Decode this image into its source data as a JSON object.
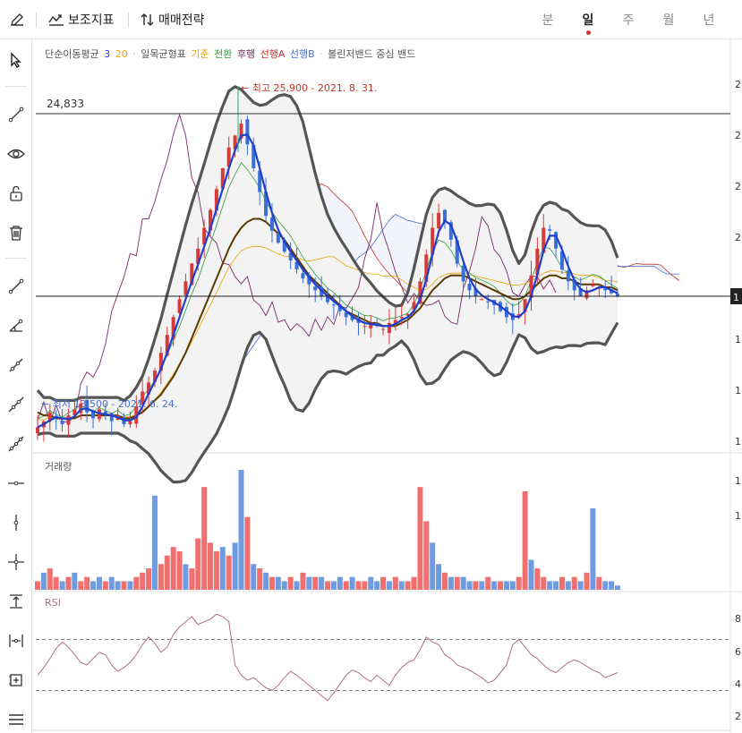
{
  "toolbar": {
    "indicators_label": "보조지표",
    "strategy_label": "매매전략",
    "periods": [
      "분",
      "일",
      "주",
      "월",
      "년"
    ],
    "active_period": "일"
  },
  "legend": {
    "sma_label": "단순이동평균",
    "sma_3": "3",
    "sma_20": "20",
    "sep": "·",
    "ichimoku_label": "일목균형표",
    "kijun": "기준",
    "tenkan": "전환",
    "chikou": "후행",
    "spanA": "선행A",
    "spanB": "선행B",
    "bollinger_label": "볼린저밴드 중심 밴드"
  },
  "colors": {
    "sma3": "#1f3fcf",
    "sma20": "#e8a400",
    "kijun": "#e8a400",
    "tenkan": "#2e9e3e",
    "chikou": "#7a2a6a",
    "spanA": "#c0352b",
    "spanB": "#4a6fd0",
    "bollinger": "#555555",
    "up": "#f07070",
    "down": "#6f9be0",
    "rsi": "#b07080"
  },
  "chart_data": [
    {
      "type": "candlestick",
      "price_line": "24,833",
      "high_annotation": "← 최고 25,900 - 2021. 8. 31.",
      "low_annotation": "← 최저 13,500 - 2021. 6. 24.",
      "high_value": 25900,
      "low_value": 13500,
      "current_reference": 18700,
      "right_axis_ticks": [
        "2",
        "2",
        "2",
        "2",
        "1",
        "1",
        "1",
        "1"
      ],
      "current_price_tag": "1",
      "close_series": [
        14300,
        14500,
        14800,
        14600,
        14400,
        14700,
        14900,
        15100,
        14800,
        14600,
        14900,
        14700,
        14500,
        14700,
        14400,
        14500,
        15000,
        15500,
        15800,
        16200,
        16800,
        17400,
        18000,
        18600,
        19200,
        19800,
        20300,
        21000,
        21600,
        22300,
        23000,
        23700,
        24100,
        24500,
        23800,
        23000,
        22200,
        21400,
        20900,
        20500,
        20200,
        19900,
        19600,
        19300,
        19100,
        18900,
        18700,
        18500,
        18400,
        18200,
        18000,
        17900,
        17800,
        17700,
        17800,
        17700,
        17600,
        17800,
        17900,
        18000,
        18100,
        18500,
        19200,
        20100,
        21000,
        21500,
        21200,
        20600,
        19800,
        19200,
        18900,
        18700,
        18600,
        18500,
        18400,
        18200,
        18000,
        17900,
        18100,
        18600,
        19400,
        20300,
        21000,
        20900,
        20300,
        19600,
        19200,
        18900,
        18700,
        18900,
        19100,
        19000,
        18900,
        18800,
        18700
      ],
      "sma20_series": [
        14800,
        14700,
        14700,
        14600,
        14600,
        14600,
        14600,
        14700,
        14700,
        14700,
        14700,
        14700,
        14700,
        14700,
        14600,
        14600,
        14700,
        14800,
        15000,
        15200,
        15400,
        15700,
        16000,
        16400,
        16800,
        17300,
        17800,
        18300,
        18800,
        19300,
        19800,
        20300,
        20700,
        21000,
        21200,
        21300,
        21300,
        21200,
        21000,
        20800,
        20600,
        20300,
        20000,
        19700,
        19400,
        19200,
        19000,
        18800,
        18600,
        18400,
        18200,
        18100,
        18000,
        17900,
        17800,
        17800,
        17700,
        17700,
        17700,
        17800,
        17900,
        18100,
        18300,
        18600,
        18900,
        19100,
        19300,
        19400,
        19400,
        19400,
        19300,
        19200,
        19100,
        19000,
        18900,
        18800,
        18700,
        18600,
        18600,
        18700,
        18900,
        19100,
        19300,
        19400,
        19400,
        19300,
        19300,
        19200,
        19100,
        19100,
        19100,
        19100,
        19000,
        19000,
        18900
      ]
    },
    {
      "type": "bar",
      "label": "거래량",
      "right_axis_ticks": [
        "1",
        "1"
      ],
      "volume_series": [
        2,
        4,
        5,
        3,
        2,
        3,
        4,
        2,
        3,
        2,
        3,
        2,
        3,
        2,
        2,
        2,
        3,
        4,
        5,
        22,
        6,
        8,
        10,
        9,
        6,
        5,
        12,
        24,
        11,
        9,
        10,
        8,
        11,
        28,
        17,
        6,
        5,
        4,
        3,
        3,
        2,
        3,
        2,
        4,
        3,
        3,
        3,
        2,
        2,
        3,
        2,
        3,
        2,
        2,
        3,
        2,
        3,
        2,
        3,
        2,
        2,
        3,
        24,
        16,
        11,
        6,
        4,
        3,
        3,
        3,
        2,
        2,
        2,
        3,
        2,
        2,
        2,
        2,
        3,
        23,
        7,
        5,
        3,
        2,
        2,
        3,
        2,
        3,
        2,
        4,
        19,
        3,
        2,
        2,
        1
      ],
      "volume_up": [
        1,
        0,
        1,
        1,
        0,
        1,
        0,
        1,
        1,
        0,
        0,
        1,
        0,
        0,
        1,
        0,
        1,
        1,
        1,
        0,
        1,
        1,
        1,
        1,
        0,
        1,
        1,
        1,
        1,
        1,
        0,
        1,
        0,
        0,
        1,
        0,
        1,
        0,
        1,
        0,
        0,
        1,
        0,
        1,
        0,
        1,
        0,
        1,
        0,
        0,
        1,
        0,
        1,
        1,
        0,
        0,
        1,
        0,
        1,
        0,
        1,
        1,
        1,
        1,
        0,
        0,
        1,
        0,
        1,
        0,
        0,
        1,
        0,
        1,
        0,
        1,
        0,
        0,
        1,
        1,
        0,
        1,
        1,
        0,
        0,
        1,
        0,
        1,
        0,
        1,
        0,
        1,
        0,
        0,
        0
      ]
    },
    {
      "type": "line",
      "label": "RSI",
      "levels": [
        70,
        30
      ],
      "right_axis_ticks": [
        "8",
        "6",
        "4",
        "2"
      ],
      "rsi_series": [
        42,
        48,
        55,
        63,
        68,
        64,
        58,
        52,
        50,
        55,
        60,
        58,
        50,
        45,
        48,
        52,
        58,
        66,
        72,
        67,
        60,
        64,
        74,
        80,
        84,
        88,
        82,
        84,
        86,
        90,
        88,
        84,
        50,
        42,
        38,
        40,
        36,
        32,
        30,
        34,
        40,
        45,
        42,
        38,
        34,
        30,
        26,
        22,
        28,
        35,
        42,
        46,
        44,
        40,
        37,
        42,
        38,
        34,
        42,
        48,
        52,
        54,
        62,
        72,
        68,
        66,
        58,
        55,
        50,
        48,
        46,
        43,
        40,
        36,
        38,
        44,
        50,
        66,
        70,
        64,
        58,
        55,
        50,
        46,
        44,
        48,
        52,
        54,
        52,
        49,
        46,
        44,
        40,
        42,
        44
      ]
    }
  ]
}
